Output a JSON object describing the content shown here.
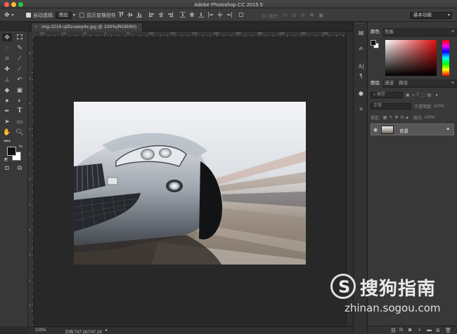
{
  "window": {
    "title": "Adobe Photoshop CC 2015.5"
  },
  "options": {
    "auto_select_label": "自动选择:",
    "auto_select_target": "图层",
    "show_transform_label": "显示变换控件",
    "mode_3d_label": "3D 模式:",
    "workspace": "基本功能"
  },
  "document": {
    "tab_title": "img-2216-sjt5zxawy4x.jpg @ 100%(RGB/8#)",
    "zoom": "100%",
    "doc_info": "文档:747.1K/747.1K"
  },
  "ruler": {
    "h_ticks": [
      "150",
      "100",
      "50",
      "0",
      "50",
      "100",
      "150",
      "200",
      "250",
      "300",
      "350",
      "400",
      "450",
      "500"
    ],
    "v_ticks": [
      "5",
      "0",
      "5",
      "1",
      "1",
      "2",
      "2",
      "3",
      "3",
      "4",
      "4"
    ]
  },
  "color_panel": {
    "tabs": [
      "颜色",
      "色板"
    ]
  },
  "layers_panel": {
    "tabs": [
      "图层",
      "通道",
      "路径"
    ],
    "filter_label": "类型",
    "blend_mode": "正常",
    "opacity_label": "不透明度:",
    "opacity_value": "100%",
    "lock_label": "锁定:",
    "fill_label": "填充:",
    "fill_value": "100%",
    "layers": [
      {
        "name": "背景"
      }
    ]
  },
  "watermark": {
    "brand": "搜狗指南",
    "url": "zhinan.sogou.com",
    "logo_letter": "S"
  }
}
